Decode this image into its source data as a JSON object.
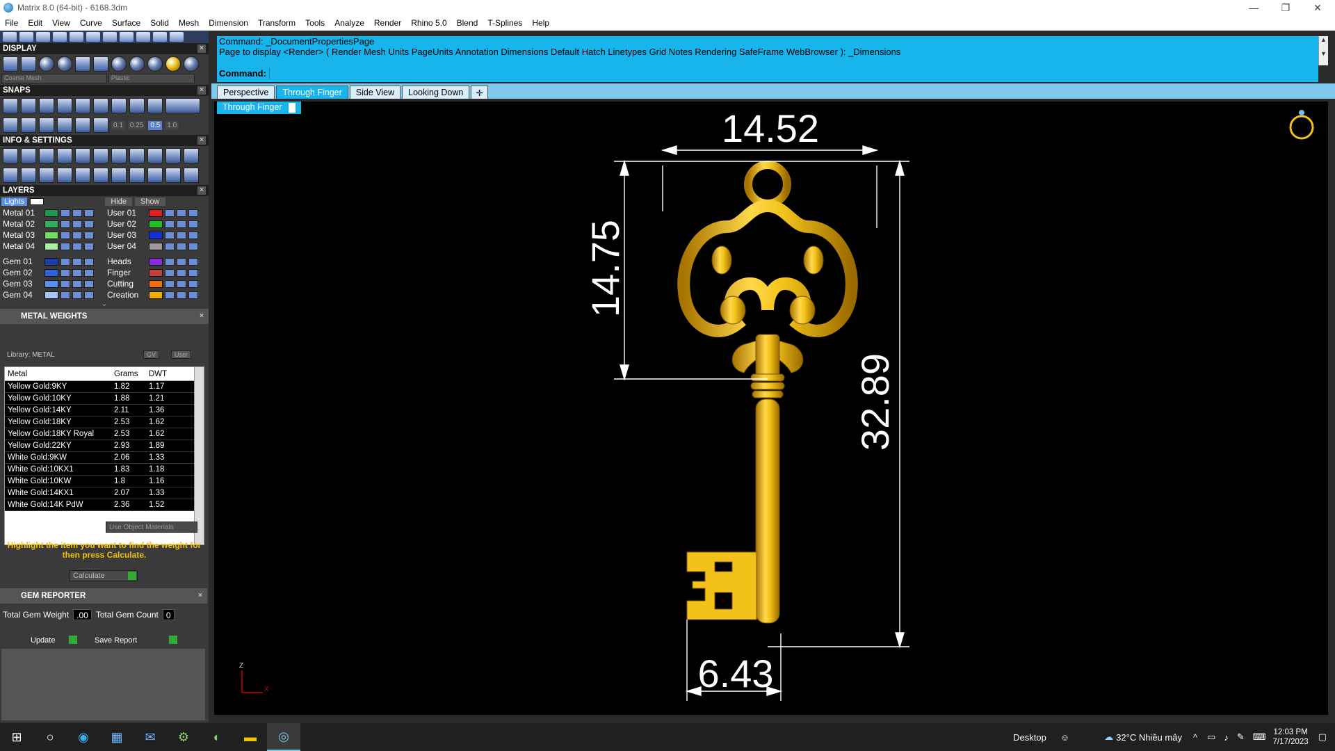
{
  "window": {
    "title": "Matrix 8.0 (64-bit) - 6168.3dm",
    "minimize": "—",
    "maximize": "❐",
    "close": "✕"
  },
  "menu": [
    "File",
    "Edit",
    "View",
    "Curve",
    "Surface",
    "Solid",
    "Mesh",
    "Dimension",
    "Transform",
    "Tools",
    "Analyze",
    "Render",
    "Rhino 5.0",
    "Blend",
    "T-Splines",
    "Help"
  ],
  "panels": {
    "display": {
      "title": "DISPLAY",
      "mesh_dropdown": "Coarse Mesh",
      "material_dropdown": "Plastic"
    },
    "snaps": {
      "title": "SNAPS",
      "values": [
        "0.1",
        "0.25",
        "0.5",
        "1.0"
      ]
    },
    "info": {
      "title": "INFO & SETTINGS"
    },
    "layers": {
      "title": "LAYERS",
      "lights_label": "Lights",
      "hide_label": "Hide",
      "show_label": "Show",
      "left": [
        {
          "name": "Metal 01",
          "color": "#1e9a4e"
        },
        {
          "name": "Metal 02",
          "color": "#2fb060"
        },
        {
          "name": "Metal 03",
          "color": "#6fe05e"
        },
        {
          "name": "Metal 04",
          "color": "#a8f0a0"
        },
        {
          "name": "Gem 01",
          "color": "#1a3fa8"
        },
        {
          "name": "Gem 02",
          "color": "#2d62d8"
        },
        {
          "name": "Gem 03",
          "color": "#5c8ef0"
        },
        {
          "name": "Gem 04",
          "color": "#a8c4f8"
        }
      ],
      "right": [
        {
          "name": "User 01",
          "color": "#e02020"
        },
        {
          "name": "User 02",
          "color": "#20c020"
        },
        {
          "name": "User 03",
          "color": "#1030e0"
        },
        {
          "name": "User 04",
          "color": "#9a9a9a"
        },
        {
          "name": "Heads",
          "color": "#8a2be2"
        },
        {
          "name": "Finger",
          "color": "#c04040"
        },
        {
          "name": "Cutting",
          "color": "#f07010"
        },
        {
          "name": "Creation",
          "color": "#f0b000"
        }
      ]
    },
    "metal_weights": {
      "title": "METAL WEIGHTS",
      "library": "Library: METAL",
      "gv_label": "GV",
      "user_label": "User",
      "columns": [
        "Metal",
        "Grams",
        "DWT"
      ],
      "rows": [
        [
          "Yellow Gold:9KY",
          "1.82",
          "1.17"
        ],
        [
          "Yellow Gold:10KY",
          "1.88",
          "1.21"
        ],
        [
          "Yellow Gold:14KY",
          "2.11",
          "1.36"
        ],
        [
          "Yellow Gold:18KY",
          "2.53",
          "1.62"
        ],
        [
          "Yellow Gold:18KY Royal",
          "2.53",
          "1.62"
        ],
        [
          "Yellow Gold:22KY",
          "2.93",
          "1.89"
        ],
        [
          "White Gold:9KW",
          "2.06",
          "1.33"
        ],
        [
          "White Gold:10KX1",
          "1.83",
          "1.18"
        ],
        [
          "White Gold:10KW",
          "1.8",
          "1.16"
        ],
        [
          "White Gold:14KX1",
          "2.07",
          "1.33"
        ],
        [
          "White Gold:14K PdW",
          "2.36",
          "1.52"
        ]
      ],
      "use_object_materials": "Use Object Materials",
      "hint": "Highlight the item you want to find the weight for then press Calculate.",
      "calculate": "Calculate"
    },
    "gem_reporter": {
      "title": "GEM REPORTER",
      "total_weight_label": "Total Gem Weight",
      "total_weight_value": ".00",
      "total_count_label": "Total Gem Count",
      "total_count_value": "0",
      "update": "Update",
      "save_report": "Save Report"
    }
  },
  "command": {
    "history_1": "Command: _DocumentPropertiesPage",
    "history_2": "Page to display <Render> ( Render  Mesh  Units  PageUnits  Annotation  Dimensions  Default  Hatch  Linetypes  Grid  Notes  Rendering  SafeFrame  WebBrowser ): _Dimensions",
    "prompt": "Command:"
  },
  "viewport_tabs": [
    "Perspective",
    "Through Finger",
    "Side View",
    "Looking Down"
  ],
  "active_tab": "Through Finger",
  "viewport_label": "Through Finger",
  "dimensions": {
    "top": "14.52",
    "left": "14.75",
    "right": "32.89",
    "bottom": "6.43"
  },
  "axis": {
    "z": "Z",
    "x": "X"
  },
  "colors": {
    "accent": "#18b4ec",
    "key_gold": "#f2c21a",
    "dim_line": "#ffffff"
  },
  "taskbar": {
    "desktop": "Desktop",
    "weather": "32°C  Nhiều mây",
    "time": "12:03 PM",
    "date": "7/17/2023"
  }
}
